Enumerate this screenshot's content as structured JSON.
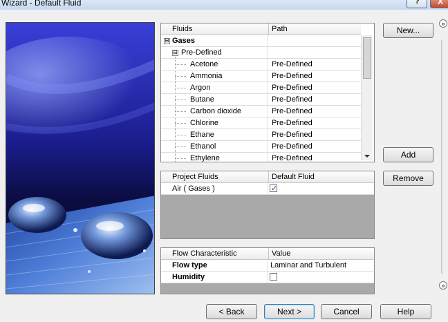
{
  "window": {
    "title": "Wizard - Default Fluid",
    "help_glyph": "?",
    "close_glyph": "X"
  },
  "fluids_table": {
    "headers": [
      "Fluids",
      "Path"
    ],
    "category": "Gases",
    "subcategory": "Pre-Defined",
    "items": [
      {
        "name": "Acetone",
        "path": "Pre-Defined"
      },
      {
        "name": "Ammonia",
        "path": "Pre-Defined"
      },
      {
        "name": "Argon",
        "path": "Pre-Defined"
      },
      {
        "name": "Butane",
        "path": "Pre-Defined"
      },
      {
        "name": "Carbon dioxide",
        "path": "Pre-Defined"
      },
      {
        "name": "Chlorine",
        "path": "Pre-Defined"
      },
      {
        "name": "Ethane",
        "path": "Pre-Defined"
      },
      {
        "name": "Ethanol",
        "path": "Pre-Defined"
      },
      {
        "name": "Ethylene",
        "path": "Pre-Defined"
      }
    ]
  },
  "project_fluids": {
    "headers": [
      "Project Fluids",
      "Default Fluid"
    ],
    "rows": [
      {
        "name": "Air ( Gases )",
        "default": true
      }
    ]
  },
  "flow": {
    "headers": [
      "Flow Characteristic",
      "Value"
    ],
    "rows": [
      {
        "label": "Flow type",
        "value": "Laminar and Turbulent"
      },
      {
        "label": "Humidity",
        "checked": false
      }
    ]
  },
  "buttons": {
    "new": "New...",
    "add": "Add",
    "remove": "Remove",
    "back": "< Back",
    "next": "Next >",
    "cancel": "Cancel",
    "help": "Help"
  },
  "icons": {
    "expand_glyph": "⊟",
    "chevron": "»",
    "check": "✓"
  }
}
